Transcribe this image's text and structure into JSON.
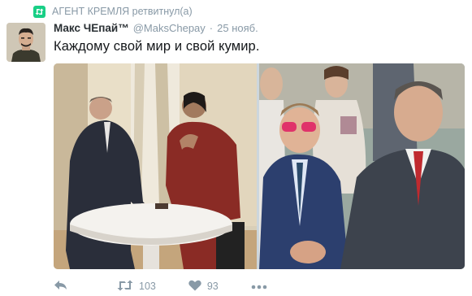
{
  "retweet_context": {
    "icon": "retweet-icon",
    "text": "АГЕНТ КРЕМЛЯ ретвитнул(а)"
  },
  "author": {
    "display_name": "Макс ЧЕпай™",
    "username": "@MaksChepay",
    "separator": "·",
    "timestamp": "25 нояб."
  },
  "tweet": {
    "text": "Каждому свой мир и свой кумир."
  },
  "media": {
    "photo_count": 2
  },
  "actions": {
    "reply_icon": "reply-icon",
    "retweet_icon": "retweet-icon",
    "retweet_count": "103",
    "like_icon": "heart-icon",
    "like_count": "93",
    "more_icon": "more-icon"
  },
  "colors": {
    "muted": "#8899a6",
    "retweet_green": "#19cf86",
    "text": "#14171a"
  }
}
